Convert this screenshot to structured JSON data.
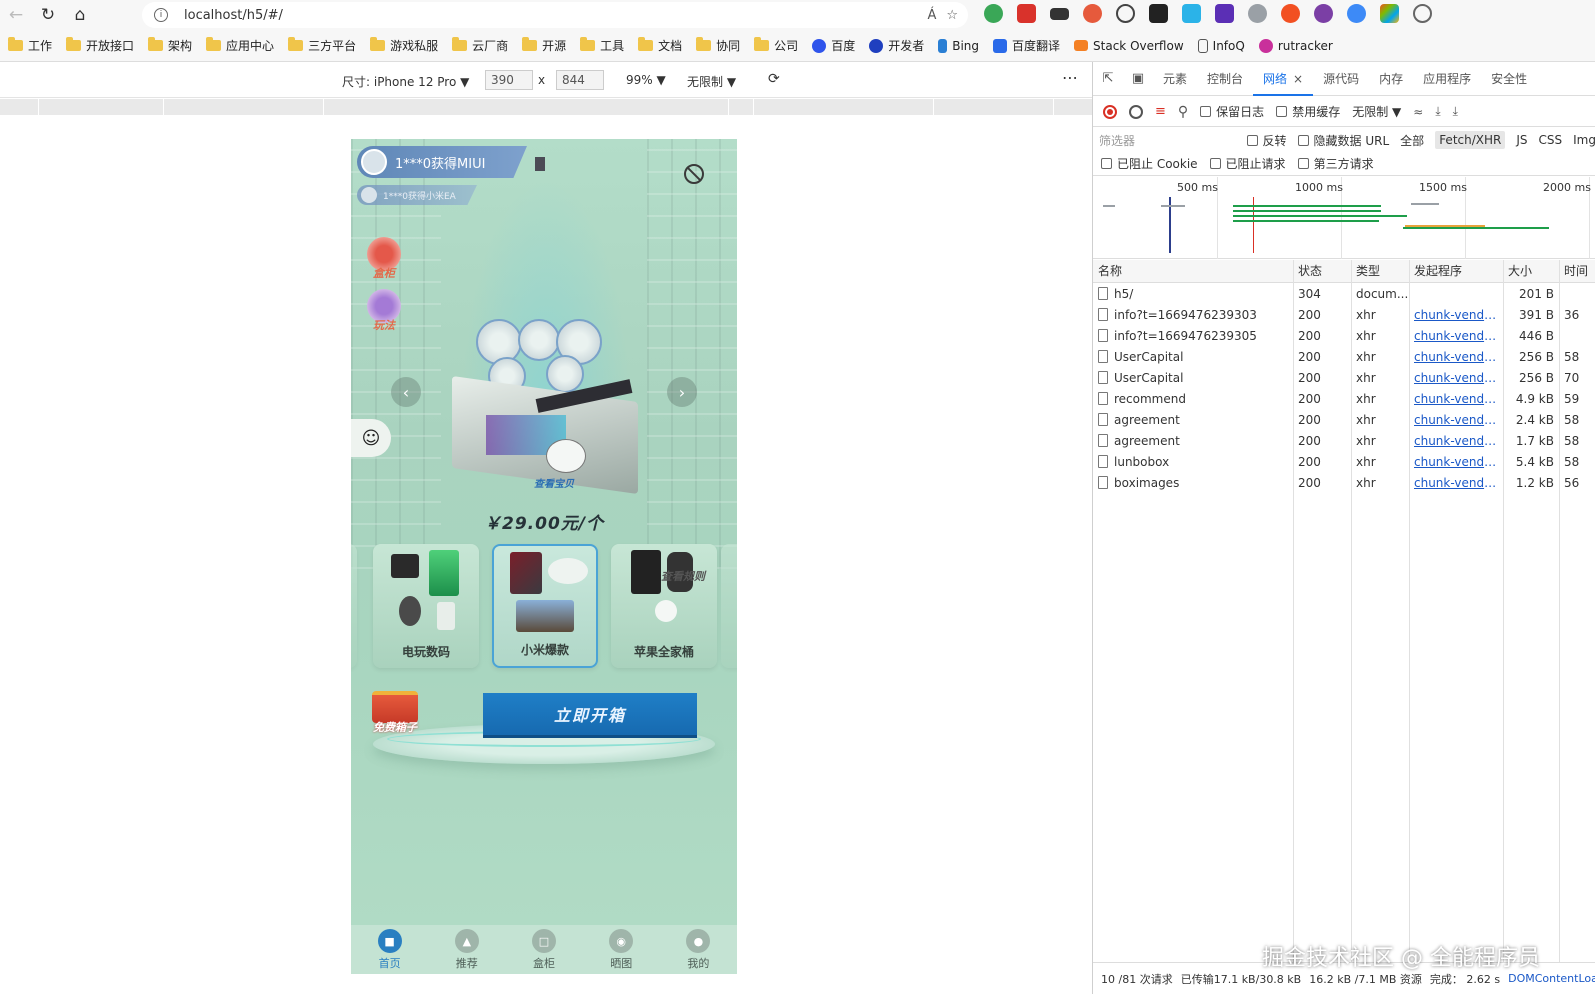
{
  "browser": {
    "url": "localhost/h5/#/",
    "bookmarks": [
      "工作",
      "开放接口",
      "架构",
      "应用中心",
      "三方平台",
      "游戏私服",
      "云厂商",
      "开源",
      "工具",
      "文档",
      "协同",
      "公司",
      "百度",
      "开发者",
      "Bing",
      "百度翻译",
      "Stack Overflow",
      "InfoQ",
      "rutracker"
    ]
  },
  "device_toolbar": {
    "dimensions_label": "尺寸: iPhone 12 Pro",
    "width": "390",
    "height": "844",
    "times": "x",
    "zoom": "99%",
    "throttle": "无限制"
  },
  "app": {
    "ticker_main": "1***0获得MIUI",
    "ticker_sub": "1***0获得小米EA",
    "side_buttons": [
      "盒柜",
      "玩法"
    ],
    "box_caption": "查看宝贝",
    "price": "￥29.00元/个",
    "cards": [
      {
        "label": "电玩数码",
        "selected": false
      },
      {
        "label": "小米爆款",
        "selected": true
      },
      {
        "label": "苹果全家桶",
        "selected": false
      }
    ],
    "card_overlay": "查看规则",
    "free_box": "免费箱子",
    "open_button": "立即开箱",
    "tabs": [
      {
        "label": "首页",
        "active": true
      },
      {
        "label": "推荐",
        "active": false
      },
      {
        "label": "盒柜",
        "active": false
      },
      {
        "label": "晒图",
        "active": false
      },
      {
        "label": "我的",
        "active": false
      }
    ]
  },
  "devtools": {
    "tabs": [
      "元素",
      "控制台",
      "网络",
      "源代码",
      "内存",
      "应用程序",
      "安全性"
    ],
    "active_tab": "网络",
    "toolbar": {
      "preserve_log": "保留日志",
      "disable_cache": "禁用缓存",
      "throttle": "无限制"
    },
    "filter": {
      "placeholder": "筛选器",
      "invert": "反转",
      "hide_data_url": "隐藏数据 URL",
      "all": "全部",
      "fetch_xhr": "Fetch/XHR",
      "js": "JS",
      "css": "CSS",
      "img": "Img",
      "blocked_cookies": "已阻止 Cookie",
      "blocked_requests": "已阻止请求",
      "third_party": "第三方请求"
    },
    "overview_ticks": [
      "500 ms",
      "1000 ms",
      "1500 ms",
      "2000 ms"
    ],
    "columns": [
      "名称",
      "状态",
      "类型",
      "发起程序",
      "大小",
      "时间"
    ],
    "rows": [
      {
        "name": "h5/",
        "status": "304",
        "type": "docum...",
        "initiator": "",
        "size": "201 B",
        "time": ""
      },
      {
        "name": "info?t=1669476239303",
        "status": "200",
        "type": "xhr",
        "initiator": "chunk-vendor...",
        "size": "391 B",
        "time": "36"
      },
      {
        "name": "info?t=1669476239305",
        "status": "200",
        "type": "xhr",
        "initiator": "chunk-vendor...",
        "size": "446 B",
        "time": ""
      },
      {
        "name": "UserCapital",
        "status": "200",
        "type": "xhr",
        "initiator": "chunk-vendor...",
        "size": "256 B",
        "time": "58"
      },
      {
        "name": "UserCapital",
        "status": "200",
        "type": "xhr",
        "initiator": "chunk-vendor...",
        "size": "256 B",
        "time": "70"
      },
      {
        "name": "recommend",
        "status": "200",
        "type": "xhr",
        "initiator": "chunk-vendor...",
        "size": "4.9 kB",
        "time": "59"
      },
      {
        "name": "agreement",
        "status": "200",
        "type": "xhr",
        "initiator": "chunk-vendor...",
        "size": "2.4 kB",
        "time": "58"
      },
      {
        "name": "agreement",
        "status": "200",
        "type": "xhr",
        "initiator": "chunk-vendor...",
        "size": "1.7 kB",
        "time": "58"
      },
      {
        "name": "lunbobox",
        "status": "200",
        "type": "xhr",
        "initiator": "chunk-vendor...",
        "size": "5.4 kB",
        "time": "58"
      },
      {
        "name": "boximages",
        "status": "200",
        "type": "xhr",
        "initiator": "chunk-vendor...",
        "size": "1.2 kB",
        "time": "56"
      }
    ],
    "status_bar": {
      "requests": "10 /81 次请求",
      "transferred": "已传输17.1 kB/30.8 kB",
      "resources": "16.2 kB /7.1 MB 资源",
      "finish": "完成： 2.62 s",
      "dcl": "DOMContentLoad"
    }
  },
  "watermark": "掘金技术社区 @ 全能程序员",
  "colors": {
    "accent": "#1a73e8",
    "open_button": "#1f7fc7",
    "record": "#d93025"
  }
}
